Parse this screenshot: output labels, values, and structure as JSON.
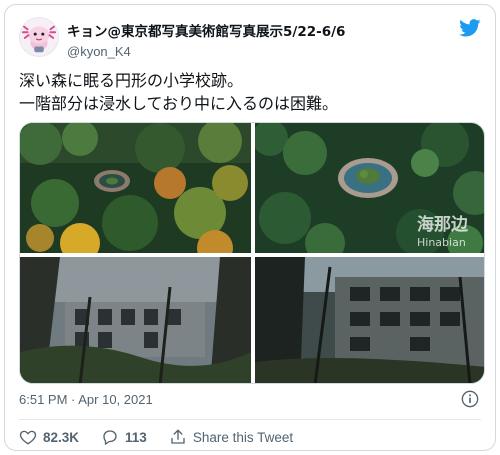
{
  "author": {
    "display_name": "キョン@東京都写真美術館写真展示5/22-6/6",
    "handle": "@kyon_K4"
  },
  "tweet": {
    "line1": "深い森に眠る円形の小学校跡。",
    "line2": "一階部分は浸水しており中に入るのは困難。"
  },
  "media": {
    "watermark_cn": "海那边",
    "watermark_en": "Hinabian"
  },
  "meta": {
    "timestamp": "6:51 PM · Apr 10, 2021"
  },
  "actions": {
    "likes": "82.3K",
    "replies": "113",
    "share_label": "Share this Tweet"
  },
  "colors": {
    "twitter_blue": "#1d9bf0",
    "like_red": "#f91880",
    "muted": "#536471"
  },
  "icons": [
    "avatar-axolotl",
    "twitter-bird-icon",
    "info-icon",
    "heart-icon",
    "reply-icon",
    "share-icon"
  ]
}
